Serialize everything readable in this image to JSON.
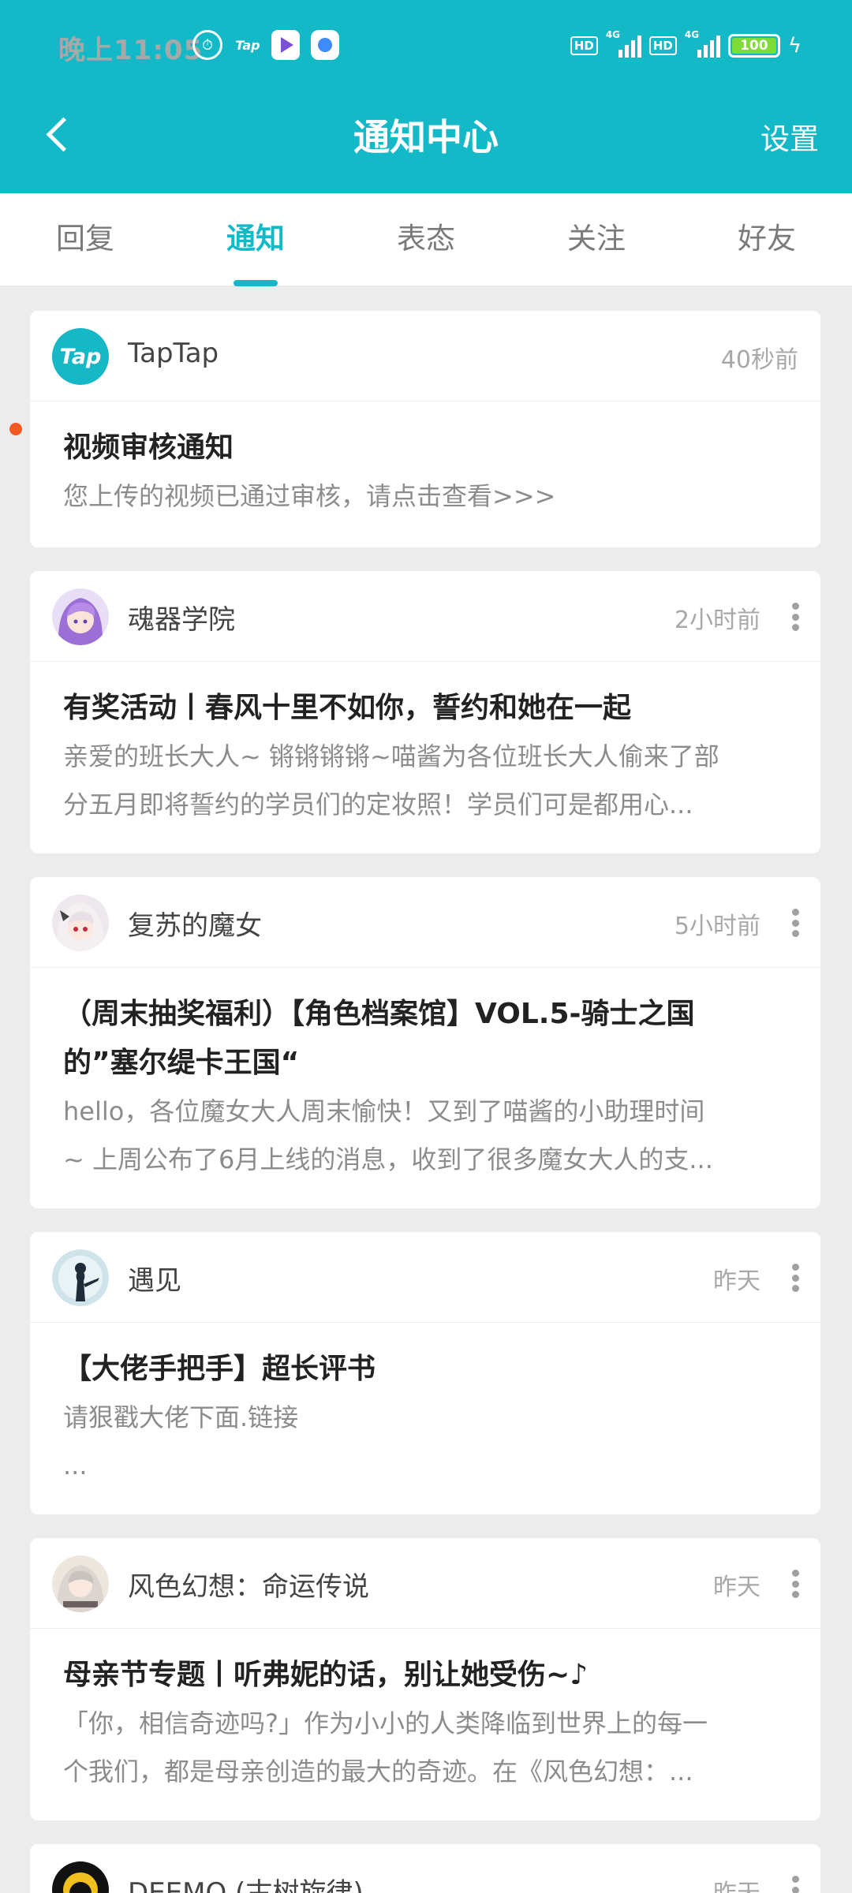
{
  "status_bar": {
    "time": "晚上11:05",
    "tap_icon_text": "Tap",
    "hd": "HD",
    "network": "4G",
    "battery": "100"
  },
  "nav": {
    "title": "通知中心",
    "settings": "设置"
  },
  "tabs": [
    "回复",
    "通知",
    "表态",
    "关注",
    "好友"
  ],
  "active_tab": "通知",
  "accent_color": "#14b9c8",
  "unread_dot_color": "#f05a24",
  "notifications": [
    {
      "avatar_text": "Tap",
      "source": "TapTap",
      "time": "40秒前",
      "title": "视频审核通知",
      "text": [
        "您上传的视频已通过审核，请点击查看>>>"
      ],
      "unread": true
    },
    {
      "source": "魂器学院",
      "time": "2小时前",
      "title": [
        "有奖活动丨春风十里不如你，誓约和她在一起"
      ],
      "text": [
        "亲爱的班长大人~ 锵锵锵锵~喵酱为各位班长大人偷来了部",
        "分五月即将誓约的学员们的定妆照！学员们可是都用心..."
      ]
    },
    {
      "source": "复苏的魔女",
      "time": "5小时前",
      "title": [
        "（周末抽奖福利）【角色档案馆】VOL.5-骑士之国",
        "的”塞尔缇卡王国“"
      ],
      "text": [
        "hello，各位魔女大人周末愉快！又到了喵酱的小助理时间",
        "~ 上周公布了6月上线的消息，收到了很多魔女大人的支..."
      ]
    },
    {
      "source": "遇见",
      "time": "昨天",
      "title": [
        "【大佬手把手】超长评书"
      ],
      "text": [
        "请狠戳大佬下面.链接",
        "..."
      ]
    },
    {
      "source": "风色幻想：命运传说",
      "time": "昨天",
      "title": [
        "母亲节专题丨听弗妮的话，别让她受伤~♪"
      ],
      "text": [
        "「你，相信奇迹吗?」作为小小的人类降临到世界上的每一",
        "个我们，都是母亲创造的最大的奇迹。在《风色幻想：..."
      ]
    },
    {
      "source": "DEEMO (古树旋律)",
      "time": "昨天"
    }
  ]
}
